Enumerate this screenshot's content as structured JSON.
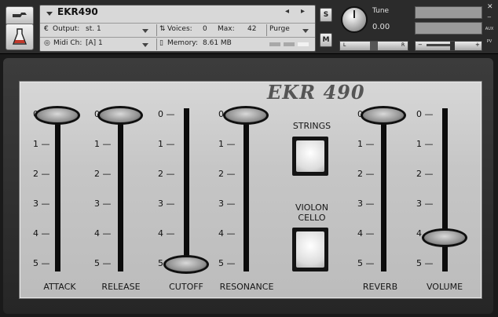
{
  "header": {
    "instrument_name": "EKR490",
    "output_label": "Output:",
    "output_value": "st. 1",
    "voices_label": "Voices:",
    "voices_value": "0",
    "max_label": "Max:",
    "max_value": "42",
    "purge_label": "Purge",
    "midi_label": "Midi Ch:",
    "midi_value": "[A]  1",
    "memory_label": "Memory:",
    "memory_value": "8.61 MB",
    "s_button": "S",
    "m_button": "M",
    "tune_label": "Tune",
    "tune_value": "0.00",
    "pan_left": "L",
    "pan_right": "R",
    "vol_minus": "−",
    "vol_plus": "+",
    "aux_label": "AUX",
    "pv_label": "PV"
  },
  "instrument": {
    "title": "EKR 490",
    "tick_labels": [
      "0",
      "1",
      "2",
      "3",
      "4",
      "5"
    ],
    "sliders": [
      {
        "id": "attack",
        "label": "ATTACK",
        "level": 0
      },
      {
        "id": "release",
        "label": "RELEASE",
        "level": 0
      },
      {
        "id": "cutoff",
        "label": "CUTOFF",
        "level": 5
      },
      {
        "id": "resonance",
        "label": "RESONANCE",
        "level": 0
      },
      {
        "id": "reverb",
        "label": "REVERB",
        "level": 0
      },
      {
        "id": "volume",
        "label": "VOLUME",
        "level": 4.1
      }
    ],
    "buttons": [
      {
        "id": "strings",
        "label": "STRINGS"
      },
      {
        "id": "violoncello",
        "label_line1": "VIOLON",
        "label_line2": "CELLO"
      }
    ]
  }
}
